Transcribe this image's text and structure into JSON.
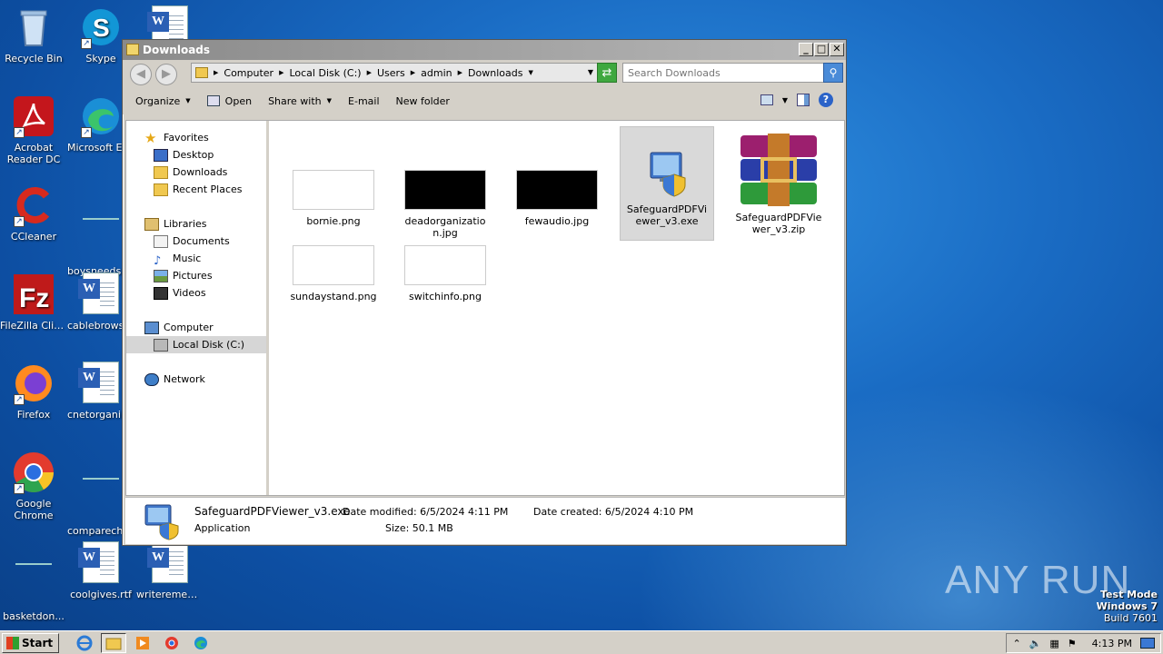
{
  "desktop": {
    "icons": [
      {
        "label": "Recycle Bin"
      },
      {
        "label": "Skype"
      },
      {
        "label": ""
      },
      {
        "label": "Acrobat Reader DC"
      },
      {
        "label": "Microsoft Edge"
      },
      {
        "label": "CCleaner"
      },
      {
        "label": "boysneeds.rtf"
      },
      {
        "label": "FileZilla Client"
      },
      {
        "label": "cablebrowser.rtf"
      },
      {
        "label": "Firefox"
      },
      {
        "label": "cnetorganization.rtf"
      },
      {
        "label": "Google Chrome"
      },
      {
        "label": "comparechange.rtf"
      },
      {
        "label": "basketdon..."
      },
      {
        "label": "coolgives.rtf"
      },
      {
        "label": "writeremem..."
      }
    ]
  },
  "window": {
    "title": "Downloads",
    "buttons": {
      "minimize": "_",
      "maximize": "□",
      "close": "✕"
    },
    "address": {
      "crumbs": [
        "Computer",
        "Local Disk (C:)",
        "Users",
        "admin",
        "Downloads"
      ]
    },
    "search": {
      "placeholder": "Search Downloads"
    },
    "toolbar": {
      "organize": "Organize",
      "open": "Open",
      "share_with": "Share with",
      "email": "E-mail",
      "new_folder": "New folder"
    },
    "nav": {
      "favorites": "Favorites",
      "desktop": "Desktop",
      "downloads": "Downloads",
      "recent_places": "Recent Places",
      "libraries": "Libraries",
      "documents": "Documents",
      "music": "Music",
      "pictures": "Pictures",
      "videos": "Videos",
      "computer": "Computer",
      "local_disk": "Local Disk (C:)",
      "network": "Network"
    },
    "files": [
      {
        "name": "bornie.png",
        "thumb": "white"
      },
      {
        "name": "deadorganization.jpg",
        "thumb": "black"
      },
      {
        "name": "fewaudio.jpg",
        "thumb": "black"
      },
      {
        "name": "SafeguardPDFViewer_v3.exe",
        "thumb": "exe",
        "selected": true
      },
      {
        "name": "SafeguardPDFViewer_v3.zip",
        "thumb": "zip"
      },
      {
        "name": "sundaystand.png",
        "thumb": "white"
      },
      {
        "name": "switchinfo.png",
        "thumb": "white"
      }
    ],
    "details": {
      "name": "SafeguardPDFViewer_v3.exe",
      "type": "Application",
      "modified": "Date modified: 6/5/2024 4:11 PM",
      "size": "Size: 50.1 MB",
      "created": "Date created: 6/5/2024 4:10 PM"
    }
  },
  "watermark": "ANY RUN",
  "sysinfo": {
    "line1": "Test Mode",
    "line2": "Windows 7",
    "line3": "Build 7601"
  },
  "taskbar": {
    "start": "Start",
    "clock": "4:13 PM"
  }
}
